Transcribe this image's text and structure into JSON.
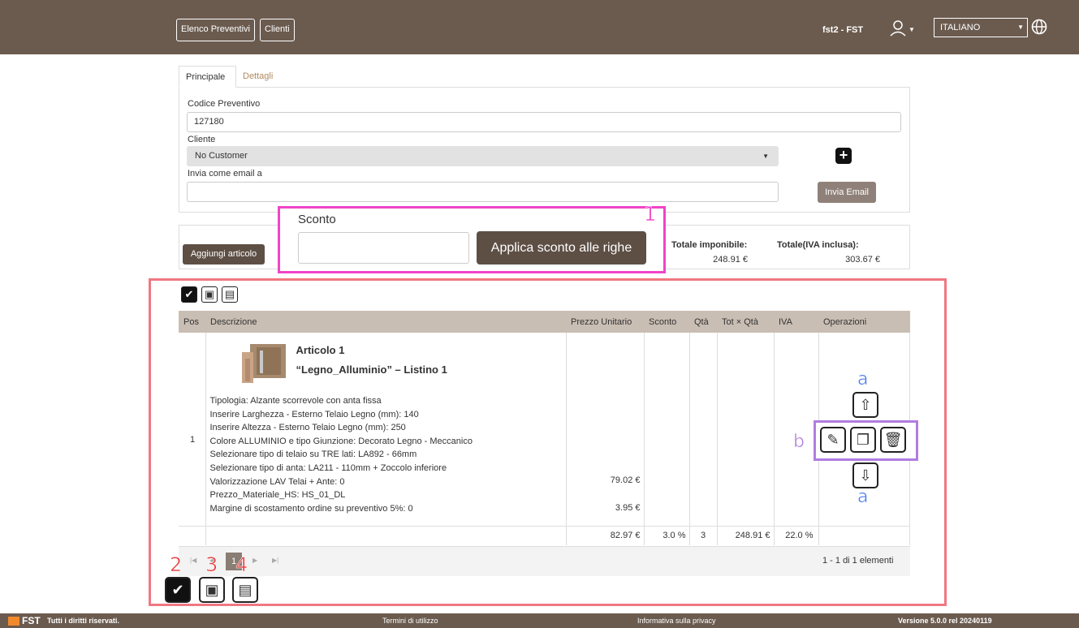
{
  "topbar": {
    "nav": [
      "Elenco Preventivi",
      "Clienti"
    ],
    "user": "fst2 - FST",
    "language": "ITALIANO"
  },
  "tabs": [
    "Principale",
    "Dettagli"
  ],
  "form": {
    "code_label": "Codice Preventivo",
    "code_value": "127180",
    "customer_label": "Cliente",
    "customer_value": "No Customer",
    "email_label": "Invia come email a",
    "email_value": "",
    "send_email": "Invia Email"
  },
  "discount": {
    "label": "Sconto",
    "value": "",
    "apply": "Applica sconto alle righe",
    "marker": "1"
  },
  "add_item": "Aggiungi articolo",
  "totals": {
    "net_label": "Totale imponibile:",
    "net_value": "248.91 €",
    "gross_label": "Totale(IVA inclusa):",
    "gross_value": "303.67 €"
  },
  "table": {
    "headers": [
      "Pos",
      "Descrizione",
      "Prezzo Unitario",
      "Sconto",
      "Qtà",
      "Tot × Qtà",
      "IVA",
      "Operazioni"
    ],
    "row": {
      "pos": "1",
      "title": "Articolo 1",
      "subtitle": "“Legno_Alluminio” – Listino 1",
      "lines": [
        "Tipologia: Alzante scorrevole con anta fissa",
        "Inserire Larghezza - Esterno Telaio Legno (mm): 140",
        "Inserire Altezza - Esterno Telaio Legno (mm): 250",
        "Colore ALLUMINIO e tipo Giunzione: Decorato Legno - Meccanico",
        "Selezionare tipo di telaio su TRE lati: LA892 - 66mm",
        "Selezionare tipo di anta: LA211 - 110mm + Zoccolo inferiore",
        "Valorizzazione LAV Telai + Ante: 0",
        "Prezzo_Materiale_HS: HS_01_DL",
        "Margine di scostamento ordine su preventivo 5%: 0"
      ],
      "price_a": "79.02 €",
      "price_b": "3.95 €",
      "unit_price": "82.97 €",
      "discount": "3.0 %",
      "qty": "3",
      "total": "248.91 €",
      "vat": "22.0 %"
    }
  },
  "ops_markers": {
    "a": "a",
    "b": "b"
  },
  "pager": {
    "page": "1",
    "info": "1 - 1 di 1 elementi"
  },
  "bottom_markers": [
    "2",
    "3",
    "4"
  ],
  "footer": {
    "brand": "FST",
    "rights": "Tutti i diritti riservati.",
    "terms": "Termini di utilizzo",
    "privacy": "Informativa sulla privacy",
    "version": "Versione 5.0.0 rel 20240119"
  }
}
